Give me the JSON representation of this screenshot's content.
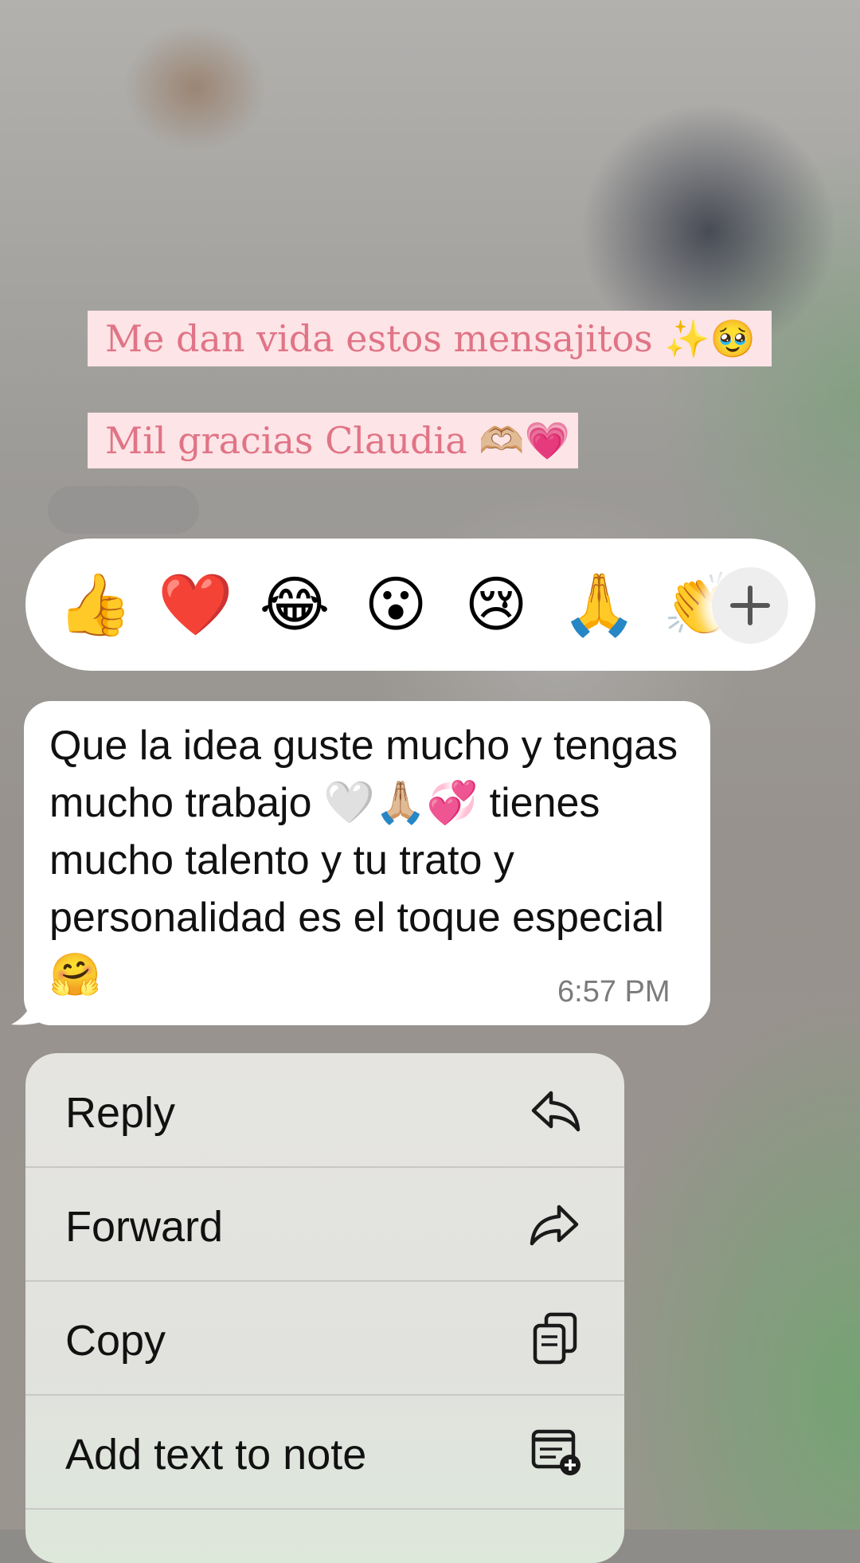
{
  "story": {
    "caption_line_1": "Me dan vida estos mensajitos ✨🥹",
    "caption_line_2": "Mil gracias Claudia 🫶🏼💗"
  },
  "reactions": {
    "items": [
      {
        "emoji": "👍",
        "icon": "thumbs-up-icon"
      },
      {
        "emoji": "❤️",
        "icon": "heart-icon"
      },
      {
        "emoji": "😂",
        "icon": "tears-of-joy-icon"
      },
      {
        "emoji": "😮",
        "icon": "surprised-face-icon"
      },
      {
        "emoji": "😢",
        "icon": "crying-face-icon"
      },
      {
        "emoji": "🙏",
        "icon": "folded-hands-icon"
      },
      {
        "emoji": "👏",
        "icon": "clapping-hands-icon"
      }
    ],
    "more_icon": "plus-icon"
  },
  "message": {
    "text": "Que la idea guste mucho y tengas mucho trabajo 🤍🙏🏼💞 tienes mucho talento y tu trato y personalidad es el toque especial 🤗",
    "time": "6:57 PM"
  },
  "menu": {
    "items": [
      {
        "label": "Reply",
        "icon": "reply-icon"
      },
      {
        "label": "Forward",
        "icon": "forward-icon"
      },
      {
        "label": "Copy",
        "icon": "copy-icon"
      },
      {
        "label": "Add text to note",
        "icon": "add-note-icon"
      }
    ]
  },
  "colors": {
    "caption_text": "#e07486",
    "caption_background": "#fde4e6",
    "bubble": "#ffffff",
    "menu_background": "#e5e4e1"
  }
}
